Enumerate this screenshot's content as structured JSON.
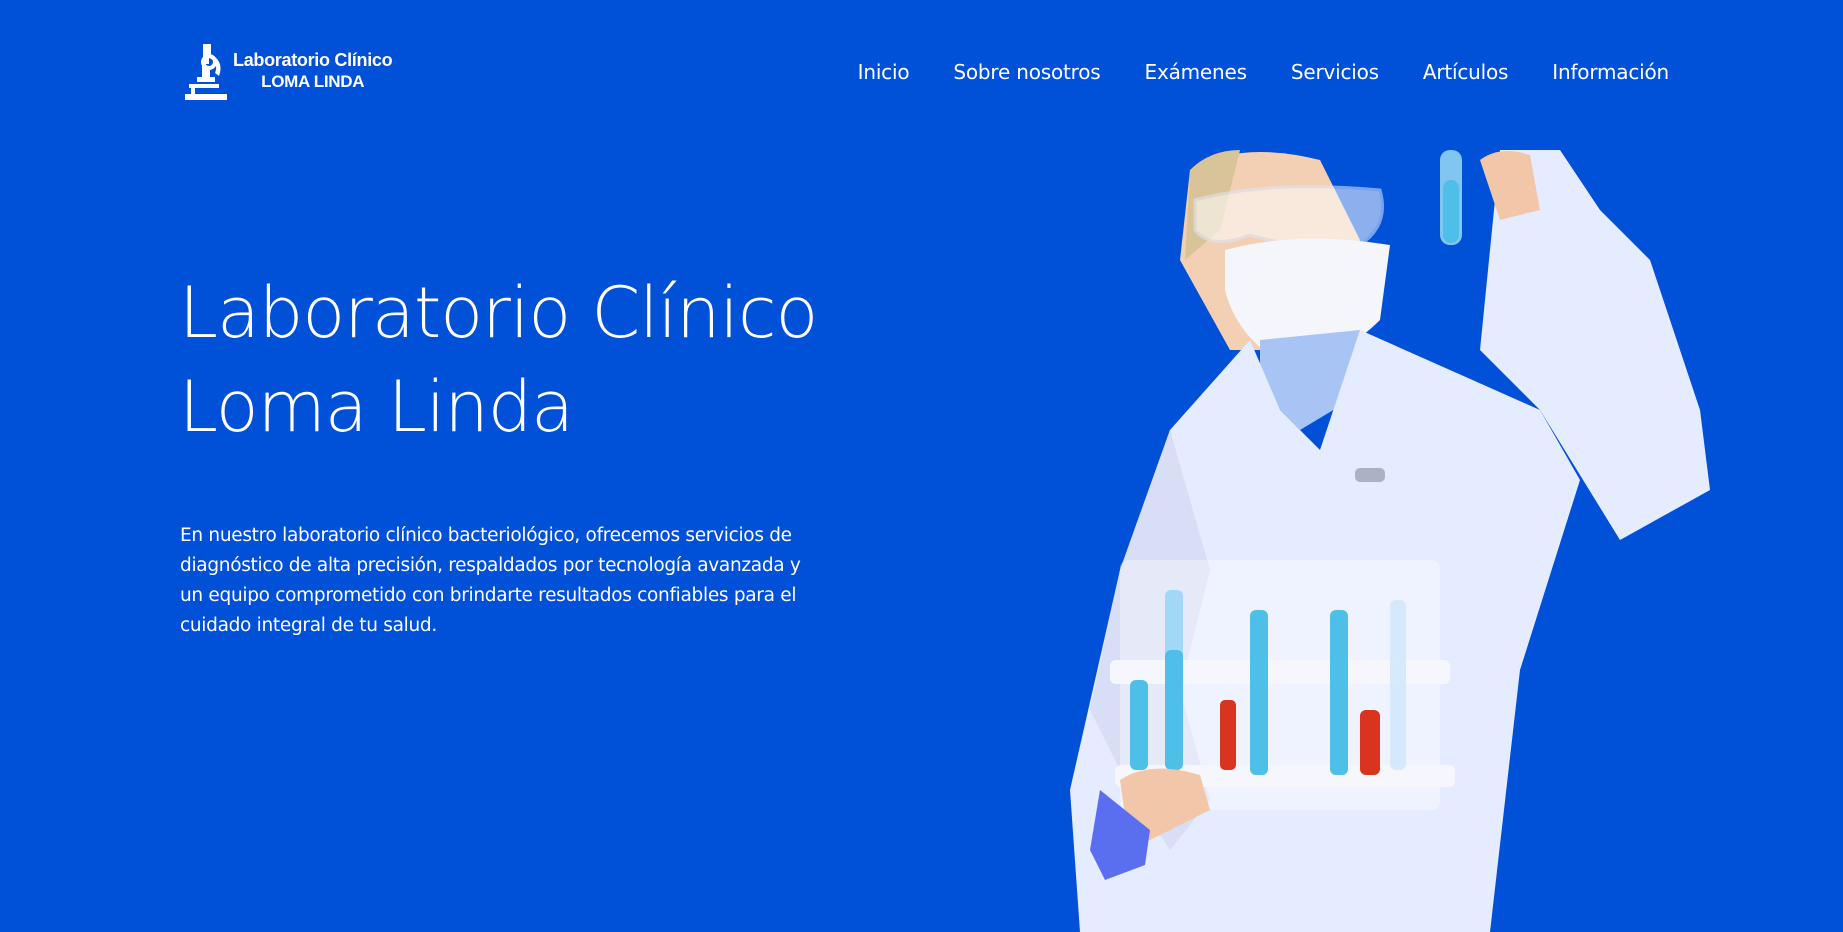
{
  "brand": {
    "line1": "Laboratorio Clínico",
    "line2": "LOMA LINDA",
    "icon": "microscope-icon"
  },
  "nav": {
    "items": [
      {
        "label": "Inicio"
      },
      {
        "label": "Sobre nosotros"
      },
      {
        "label": "Exámenes"
      },
      {
        "label": "Servicios"
      },
      {
        "label": "Artículos"
      },
      {
        "label": "Información"
      }
    ]
  },
  "hero": {
    "title_line1": "Laboratorio Clínico",
    "title_line2": "Loma Linda",
    "description": "En nuestro laboratorio clínico bacteriológico, ofrecemos servicios de diagnóstico de alta precisión, respaldados por tecnología avanzada y un equipo comprometido con brindarte resultados confiables para el cuidado integral de tu salud."
  },
  "colors": {
    "background": "#0150d8",
    "text": "#ffffff",
    "lab_coat": "#e6ecff",
    "shirt": "#a7c4f5",
    "liquid_blue": "#4dbfe8",
    "liquid_red": "#d8341f"
  }
}
